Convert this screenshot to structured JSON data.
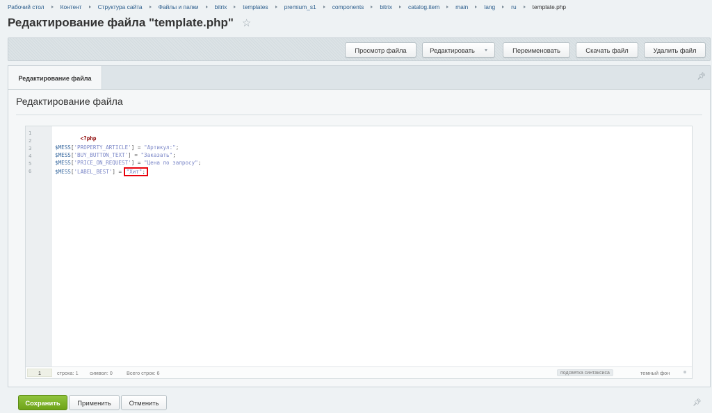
{
  "breadcrumb": [
    "Рабочий стол",
    "Контент",
    "Структура сайта",
    "Файлы и папки",
    "bitrix",
    "templates",
    "premium_s1",
    "components",
    "bitrix",
    "catalog.item",
    "main",
    "lang",
    "ru",
    "template.php"
  ],
  "page": {
    "title": "Редактирование файла \"template.php\"",
    "favorite_icon": "star-icon"
  },
  "toolbar": {
    "view_label": "Просмотр файла",
    "edit_label": "Редактировать",
    "rename_label": "Переименовать",
    "download_label": "Скачать файл",
    "delete_label": "Удалить файл"
  },
  "tabs": {
    "active_label": "Редактирование файла",
    "pin_icon": "pin-icon"
  },
  "section": {
    "title": "Редактирование файла"
  },
  "editor": {
    "line_numbers": [
      "1",
      "2",
      "3",
      "4",
      "5",
      "6"
    ],
    "lines": [
      {
        "php_open": "<?php"
      },
      {},
      {
        "var": "$MESS",
        "open": "[",
        "key": "'PROPERTY_ARTICLE'",
        "close": "]",
        "eq": " = ",
        "value": "\"Артикул:\"",
        "end": ";"
      },
      {
        "var": "$MESS",
        "open": "[",
        "key": "'BUY_BUTTON_TEXT'",
        "close": "]",
        "eq": " = ",
        "value": "\"Заказать\"",
        "end": ";"
      },
      {
        "var": "$MESS",
        "open": "[",
        "key": "'PRICE_ON_REQUEST'",
        "close": "]",
        "eq": " = ",
        "value": "\"Цена по запросу\"",
        "end": ";"
      },
      {
        "var": "$MESS",
        "open": "[",
        "key": "'LABEL_BEST'",
        "close": "]",
        "eq": " = ",
        "value": "\"Хит\"",
        "end": ";"
      }
    ],
    "status": {
      "current_line": "1",
      "position": "строка: 1",
      "char": "символ: 0",
      "total": "Всего строк: 6",
      "syntax": "подсветка синтаксиса",
      "theme": "темный фон"
    },
    "highlight_color": "#e8000b"
  },
  "actions": {
    "save": "Сохранить",
    "apply": "Применить",
    "cancel": "Отменить"
  },
  "colors": {
    "save_button": "#7cb32a",
    "link": "#2b5d8c"
  }
}
